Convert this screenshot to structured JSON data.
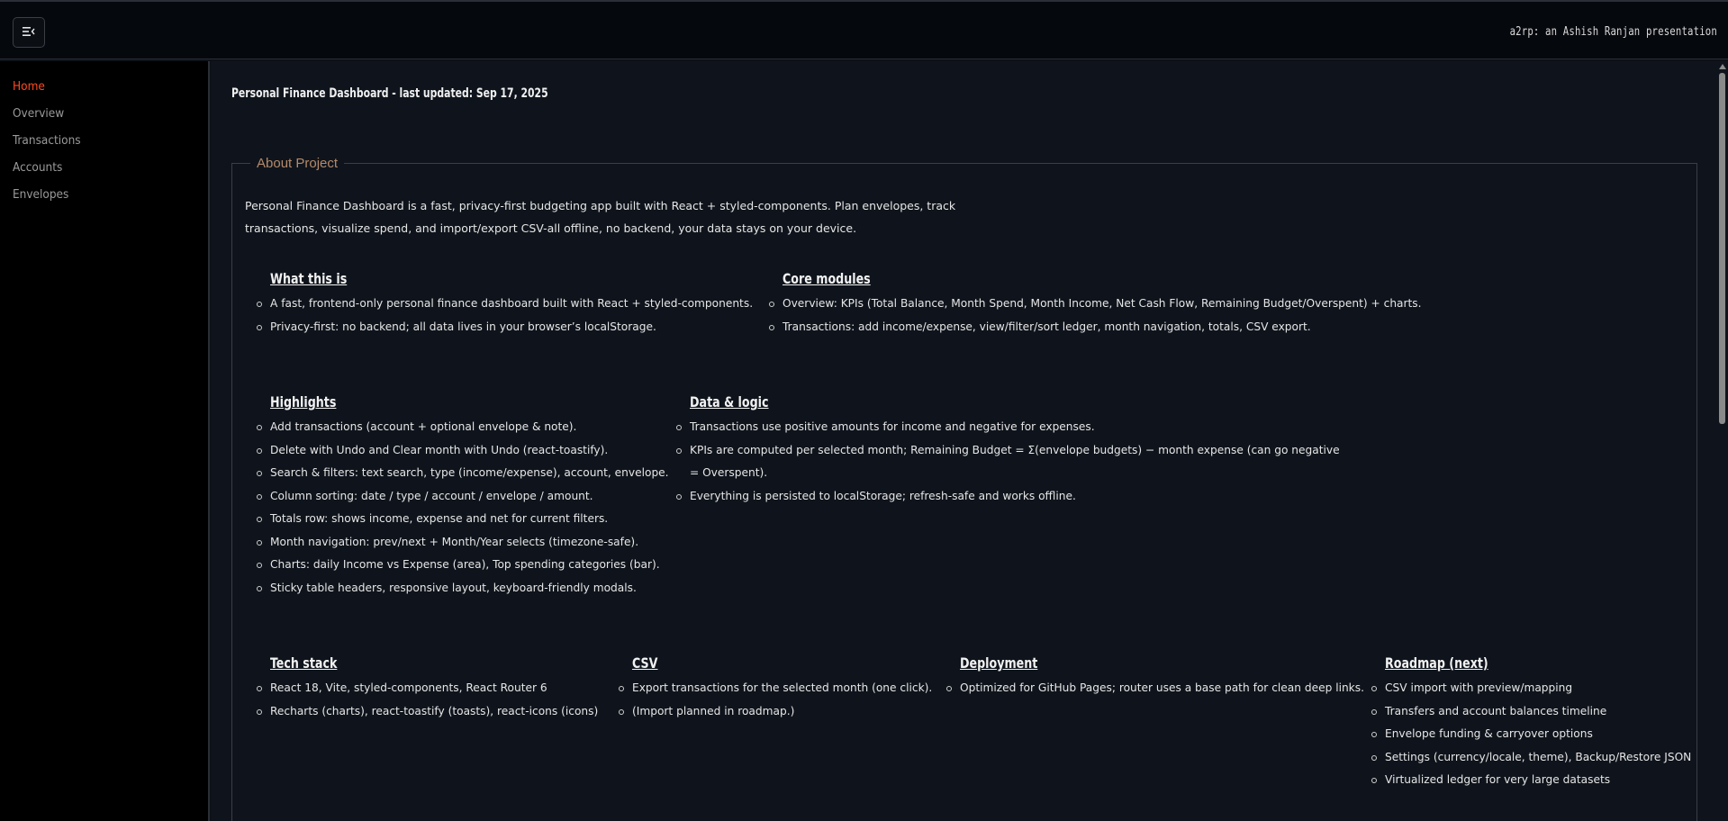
{
  "header": {
    "menu_icon": "menu-collapse-icon",
    "brand": "a2rp: an Ashish Ranjan presentation"
  },
  "sidebar": {
    "items": [
      {
        "label": "Home",
        "active": true
      },
      {
        "label": "Overview",
        "active": false
      },
      {
        "label": "Transactions",
        "active": false
      },
      {
        "label": "Accounts",
        "active": false
      },
      {
        "label": "Envelopes",
        "active": false
      }
    ]
  },
  "main": {
    "title": "Personal Finance Dashboard - last updated: Sep 17, 2025",
    "about": {
      "legend": "About Project",
      "intro": "Personal Finance Dashboard is a fast, privacy-first budgeting app built with React + styled-components. Plan envelopes, track transactions, visualize spend, and import/export CSV-all offline, no backend, your data stays on your device."
    },
    "sections": {
      "what": {
        "title": "What this is",
        "items": [
          "A fast, frontend-only personal finance dashboard built with React + styled-components.",
          "Privacy-first: no backend; all data lives in your browser’s localStorage."
        ]
      },
      "core": {
        "title": "Core modules",
        "items": [
          "Overview: KPIs (Total Balance, Month Spend, Month Income, Net Cash Flow, Remaining Budget/Overspent) + charts.",
          "Transactions: add income/expense, view/filter/sort ledger, month navigation, totals, CSV export."
        ]
      },
      "highlights": {
        "title": "Highlights",
        "items": [
          "Add transactions (account + optional envelope & note).",
          "Delete with Undo and Clear month with Undo (react-toastify).",
          "Search & filters: text search, type (income/expense), account, envelope.",
          "Column sorting: date / type / account / envelope / amount.",
          "Totals row: shows income, expense and net for current filters.",
          "Month navigation: prev/next + Month/Year selects (timezone-safe).",
          "Charts: daily Income vs Expense (area), Top spending categories (bar).",
          "Sticky table headers, responsive layout, keyboard-friendly modals."
        ]
      },
      "logic": {
        "title": "Data & logic",
        "items": [
          "Transactions use positive amounts for income and negative for expenses.",
          "KPIs are computed per selected month; Remaining Budget = Σ(envelope budgets) − month expense (can go negative = Overspent).",
          "Everything is persisted to localStorage; refresh-safe and works offline."
        ]
      },
      "tech": {
        "title": "Tech stack",
        "items": [
          "React 18, Vite, styled-components, React Router 6",
          "Recharts (charts), react-toastify (toasts), react-icons (icons)"
        ]
      },
      "csv": {
        "title": "CSV",
        "items": [
          "Export transactions for the selected month (one click).",
          "(Import planned in roadmap.)"
        ]
      },
      "deploy": {
        "title": "Deployment",
        "items": [
          "Optimized for GitHub Pages; router uses a base path for clean deep links."
        ]
      },
      "roadmap": {
        "title": "Roadmap (next)",
        "items": [
          "CSV import with preview/mapping",
          "Transfers and account balances timeline",
          "Envelope funding & carryover options",
          "Settings (currency/locale, theme), Backup/Restore JSON",
          "Virtualized ledger for very large datasets"
        ]
      }
    }
  }
}
